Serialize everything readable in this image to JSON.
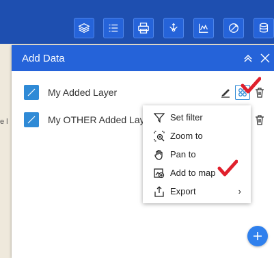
{
  "panel": {
    "title": "Add Data"
  },
  "layers": [
    {
      "name": "My Added Layer"
    },
    {
      "name": "My OTHER Added Laye"
    }
  ],
  "context_menu": {
    "items": [
      {
        "label": "Set filter",
        "icon": "filter-icon"
      },
      {
        "label": "Zoom to",
        "icon": "zoom-to-icon"
      },
      {
        "label": "Pan to",
        "icon": "pan-hand-icon"
      },
      {
        "label": "Add to map",
        "icon": "add-to-map-icon"
      },
      {
        "label": "Export",
        "icon": "export-icon",
        "submenu": "›"
      }
    ]
  },
  "map": {
    "edge_label": "e l"
  },
  "colors": {
    "primary": "#2563d9",
    "layer_swatch": "#2f8ad6",
    "annotation_check": "#e0202c"
  }
}
